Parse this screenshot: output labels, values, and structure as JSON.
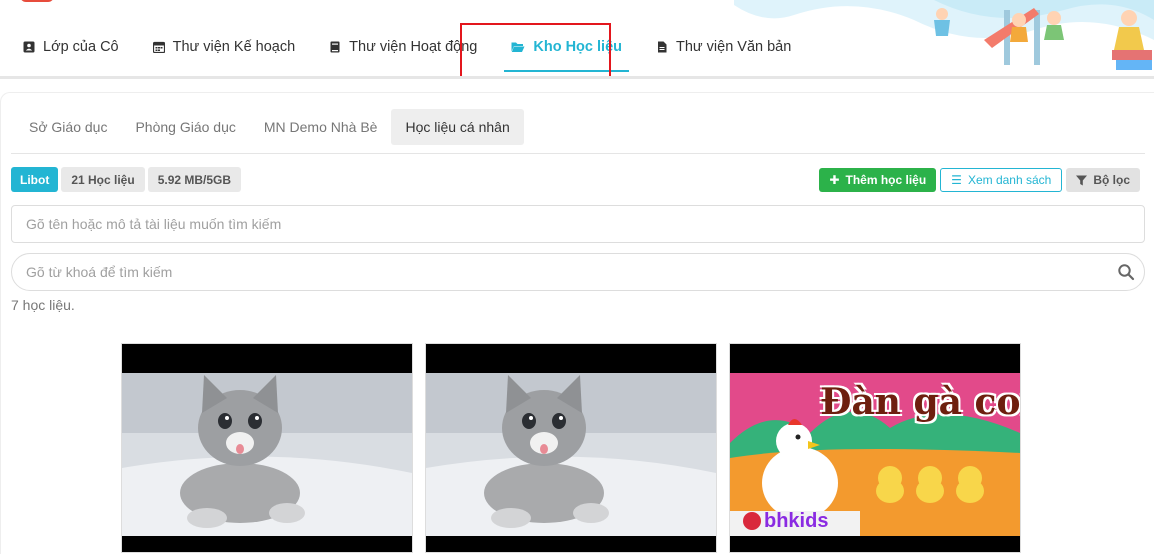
{
  "nav": {
    "items": [
      {
        "label": "Lớp của Cô",
        "icon": "contact-card-icon"
      },
      {
        "label": "Thư viện Kế hoạch",
        "icon": "calendar-icon"
      },
      {
        "label": "Thư viện Hoạt động",
        "icon": "book-icon"
      },
      {
        "label": "Kho Học liệu",
        "icon": "folder-open-icon",
        "active": true
      },
      {
        "label": "Thư viện Văn bản",
        "icon": "document-icon"
      }
    ]
  },
  "subtabs": [
    {
      "label": "Sở Giáo dục"
    },
    {
      "label": "Phòng Giáo dục"
    },
    {
      "label": "MN Demo Nhà Bè"
    },
    {
      "label": "Học liệu cá nhân",
      "active": true
    }
  ],
  "badges": {
    "libot": "Libot",
    "count": "21 Học liệu",
    "storage": "5.92 MB/5GB"
  },
  "actions": {
    "add_label": "Thêm học liệu",
    "list_label": "Xem danh sách",
    "filter_label": "Bộ lọc"
  },
  "search": {
    "desc_placeholder": "Gõ tên hoặc mô tả tài liệu muốn tìm kiếm",
    "keyword_placeholder": "Gõ từ khoá để tìm kiếm"
  },
  "result_count": "7 học liệu.",
  "thumbnails": [
    {
      "image": "kitten-photo"
    },
    {
      "image": "kitten-photo"
    },
    {
      "image": "cartoon-chickens",
      "title": "Đàn gà con",
      "brand": "bhkids"
    }
  ],
  "colors": {
    "accent": "#23b5d3",
    "add_button": "#2cb24a",
    "highlight_box": "#e3161d"
  }
}
